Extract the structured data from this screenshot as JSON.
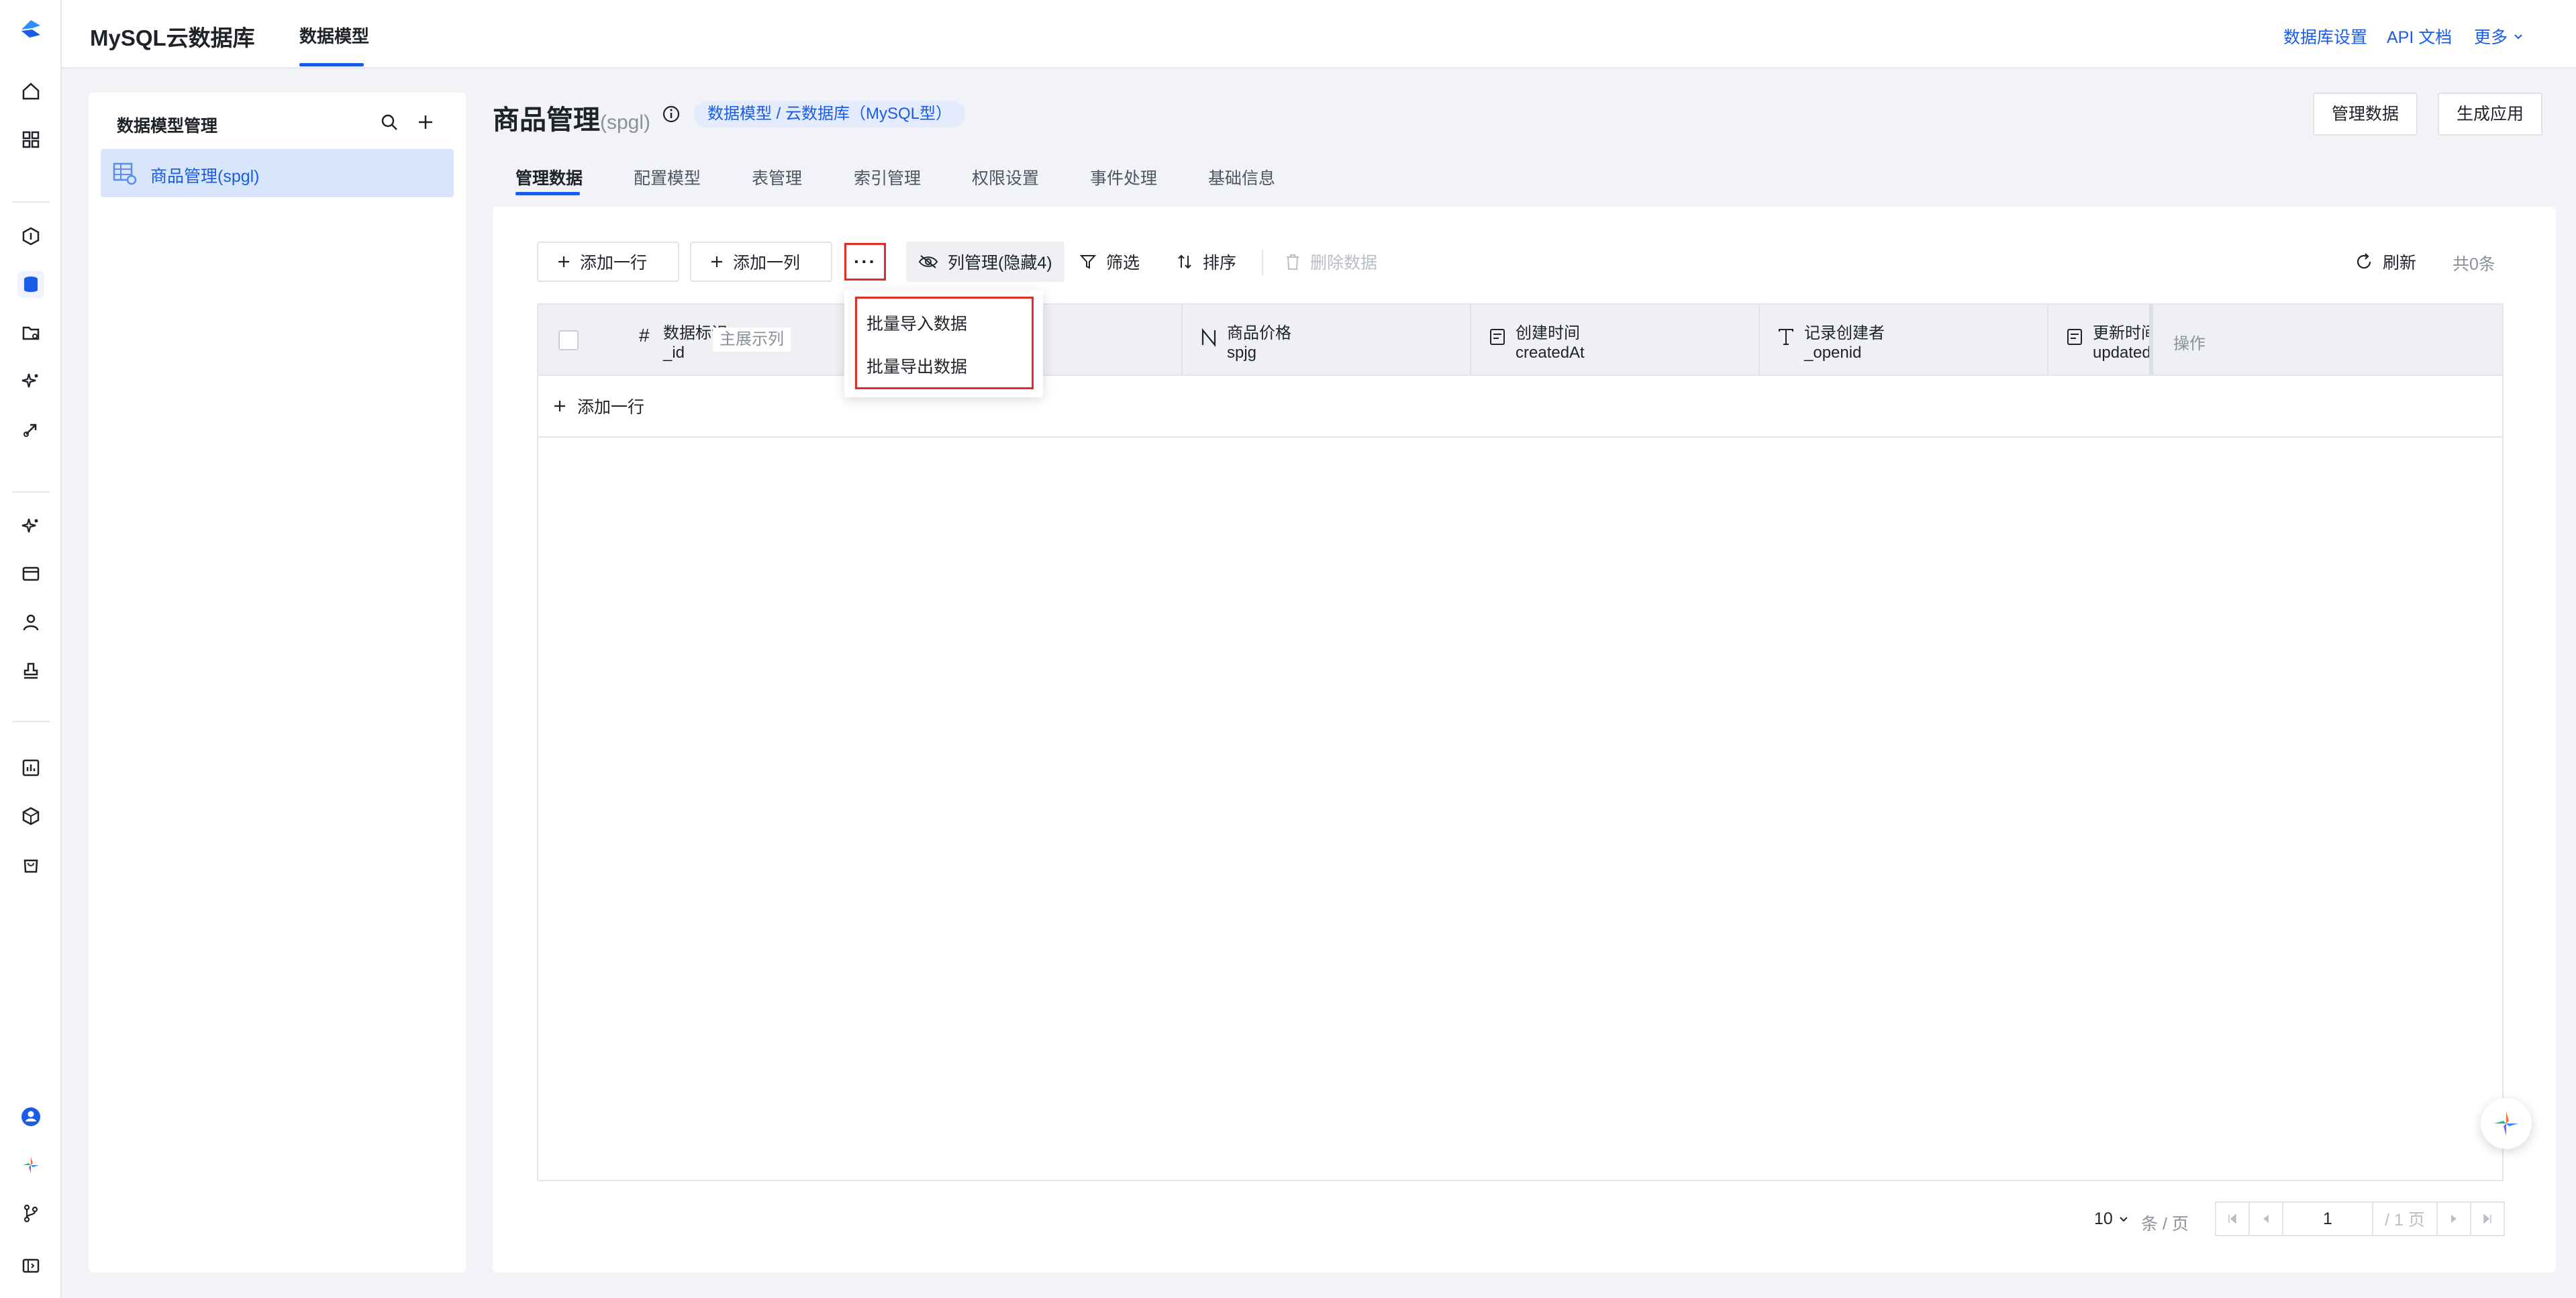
{
  "app": {
    "title": "MySQL云数据库",
    "active_tab": "数据模型"
  },
  "top_links": {
    "db_settings": "数据库设置",
    "api_docs": "API 文档",
    "more": "更多"
  },
  "model_panel": {
    "title": "数据模型管理",
    "items": [
      {
        "label": "商品管理(spgl)"
      }
    ]
  },
  "page": {
    "title": "商品管理",
    "title_sub": "(spgl)",
    "breadcrumb": "数据模型 / 云数据库（MySQL型）",
    "manage_data_button": "管理数据",
    "generate_app_button": "生成应用"
  },
  "tabs": [
    "管理数据",
    "配置模型",
    "表管理",
    "索引管理",
    "权限设置",
    "事件处理",
    "基础信息"
  ],
  "toolbar": {
    "add_row": "添加一行",
    "add_column": "添加一列",
    "more": "···",
    "column_manage": "列管理(隐藏4)",
    "filter": "筛选",
    "sort": "排序",
    "delete": "删除数据",
    "refresh": "刷新",
    "count": "共0条"
  },
  "dropdown": {
    "items": [
      "批量导入数据",
      "批量导出数据"
    ]
  },
  "table": {
    "columns": [
      {
        "name": "数据标识",
        "key": "_id",
        "icon": "hash-icon",
        "tag": "主展示列"
      },
      {
        "name": "商品价格",
        "key": "spjg",
        "icon": "number-icon"
      },
      {
        "name": "创建时间",
        "key": "createdAt",
        "icon": "datetime-icon"
      },
      {
        "name": "记录创建者",
        "key": "_openid",
        "icon": "text-icon"
      },
      {
        "name": "更新时间",
        "key": "updatedAt",
        "icon": "datetime-icon"
      }
    ],
    "ops_header": "操作",
    "add_row_label": "添加一行"
  },
  "pagination": {
    "page_size": "10",
    "unit": "条 / 页",
    "current_page": "1",
    "total_pages": "/ 1 页"
  },
  "colors": {
    "accent": "#1a5ce6",
    "highlight": "#e02b2b",
    "selected_bg": "#d9e5fb"
  }
}
